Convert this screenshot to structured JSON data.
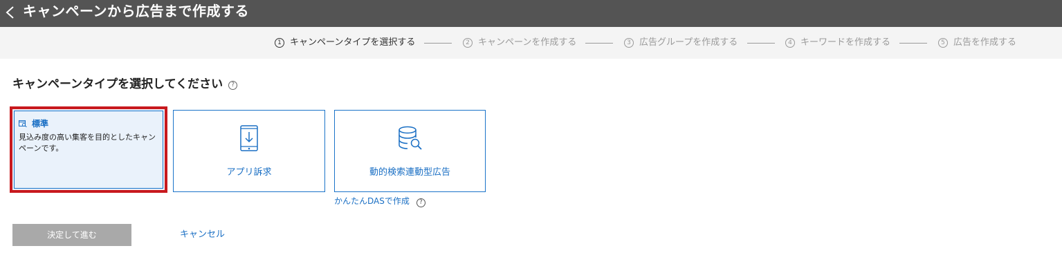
{
  "header": {
    "title": "キャンペーンから広告まで作成する"
  },
  "steps": [
    {
      "num": "1",
      "label": "キャンペーンタイプを選択する",
      "active": true
    },
    {
      "num": "2",
      "label": "キャンペーンを作成する",
      "active": false
    },
    {
      "num": "3",
      "label": "広告グループを作成する",
      "active": false
    },
    {
      "num": "4",
      "label": "キーワードを作成する",
      "active": false
    },
    {
      "num": "5",
      "label": "広告を作成する",
      "active": false
    }
  ],
  "main": {
    "title": "キャンペーンタイプを選択してください",
    "help": "?"
  },
  "cards": {
    "standard": {
      "title": "標準",
      "description": "見込み度の高い集客を目的としたキャンペーンです。",
      "selected": true
    },
    "app": {
      "label": "アプリ訴求"
    },
    "das": {
      "label": "動的検索連動型広告"
    }
  },
  "das_link": {
    "label": "かんたんDASで作成",
    "help": "?"
  },
  "actions": {
    "next_label": "決定して進む",
    "cancel_label": "キャンセル"
  },
  "colors": {
    "header_bg": "#545454",
    "accent": "#1a6fc4",
    "selected_border": "#c8191e",
    "disabled_button": "#a9a9a9"
  }
}
